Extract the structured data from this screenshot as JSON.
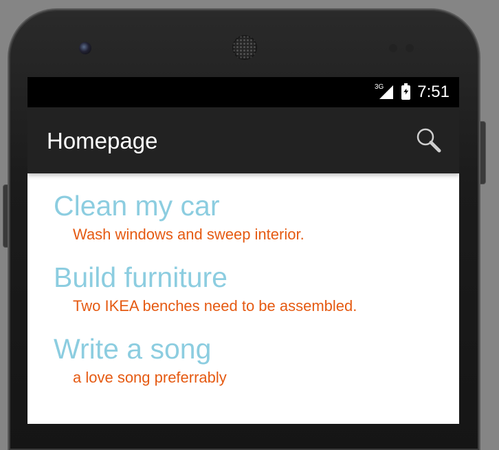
{
  "status_bar": {
    "network_type": "3G",
    "time": "7:51"
  },
  "action_bar": {
    "title": "Homepage",
    "search_icon": "search-icon"
  },
  "tasks": [
    {
      "title": "Clean my car",
      "description": "Wash windows and sweep interior."
    },
    {
      "title": "Build furniture",
      "description": "Two IKEA benches need to be assembled."
    },
    {
      "title": "Write a song",
      "description": "a love song preferrably"
    }
  ],
  "colors": {
    "action_bar": "#222222",
    "task_title": "#8ccde0",
    "task_description": "#e55a12",
    "status_bar": "#000000"
  }
}
